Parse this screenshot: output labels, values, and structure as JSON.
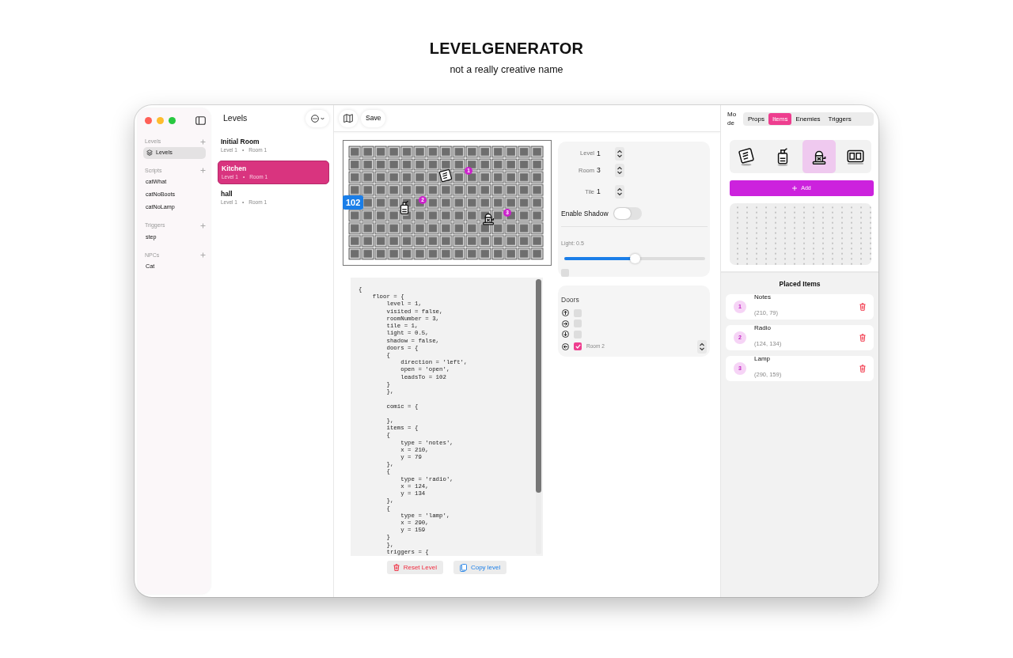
{
  "header": {
    "title": "LEVELGENERATOR",
    "subtitle": "not a really creative name"
  },
  "sidebar": {
    "sections": [
      {
        "title": "Levels",
        "items": [
          {
            "label": "Levels",
            "selected": true
          }
        ]
      },
      {
        "title": "Scripts",
        "items": [
          {
            "label": "catWhat",
            "selected": false
          },
          {
            "label": "catNoBoots",
            "selected": false
          },
          {
            "label": "catNoLamp",
            "selected": false
          }
        ]
      },
      {
        "title": "Triggers",
        "items": [
          {
            "label": "step",
            "selected": false
          }
        ]
      },
      {
        "title": "NPCs",
        "items": [
          {
            "label": "Cat",
            "selected": false
          }
        ]
      }
    ]
  },
  "levels_list": {
    "title": "Levels",
    "items": [
      {
        "name": "Initial Room",
        "level": "Level 1",
        "separator": "•",
        "room": "Room 1",
        "selected": false
      },
      {
        "name": "Kitchen",
        "level": "Level 1",
        "separator": "•",
        "room": "Room 1",
        "selected": true
      },
      {
        "name": "hall",
        "level": "Level 1",
        "separator": "•",
        "room": "Room 1",
        "selected": false
      }
    ]
  },
  "toolbar": {
    "save": "Save"
  },
  "map": {
    "door_label": "102",
    "markers": [
      {
        "number": "1",
        "kind": "notebook"
      },
      {
        "number": "2",
        "kind": "bottle"
      },
      {
        "number": "3",
        "kind": "lamp"
      }
    ]
  },
  "settings": {
    "fields": [
      {
        "label": "Level",
        "value": "1"
      },
      {
        "label": "Room",
        "value": "3"
      },
      {
        "label": "Tile",
        "value": "1"
      }
    ],
    "shadow": {
      "label": "Enable Shadow",
      "on": false
    },
    "light": {
      "label": "Light: 0.5",
      "level": 0.5
    },
    "extra_checkbox": {
      "checked": false
    }
  },
  "doors": {
    "title": "Doors",
    "rows": [
      {
        "kind": "up",
        "checked": false
      },
      {
        "kind": "right",
        "checked": false
      },
      {
        "kind": "down",
        "checked": false
      },
      {
        "kind": "left",
        "checked": true,
        "target": "Room 2"
      }
    ]
  },
  "code": "{\n    floor = {\n        level = 1,\n        visited = false,\n        roomNumber = 3,\n        tile = 1,\n        light = 0.5,\n        shadow = false,\n        doors = {\n        {\n            direction = 'left',\n            open = 'open',\n            leadsTo = 102\n        }\n        },\n\n        comic = {\n\n        },\n        items = {\n        {\n            type = 'notes',\n            x = 210,\n            y = 79\n        },\n        {\n            type = 'radio',\n            x = 124,\n            y = 134\n        },\n        {\n            type = 'lamp',\n            x = 290,\n            y = 159\n        }\n        },\n        triggers = {",
  "actions": [
    {
      "kind": "reset",
      "label": "Reset Level"
    },
    {
      "kind": "copy",
      "label": "Copy level"
    }
  ],
  "mode": {
    "label": "Mode",
    "tabs": [
      {
        "label": "Props",
        "selected": false
      },
      {
        "label": "Items",
        "selected": true
      },
      {
        "label": "Enemies",
        "selected": false
      },
      {
        "label": "Triggers",
        "selected": false
      }
    ]
  },
  "picker": [
    {
      "kind": "notebook",
      "selected": false
    },
    {
      "kind": "bottle",
      "selected": false
    },
    {
      "kind": "lamp",
      "selected": true
    },
    {
      "kind": "device",
      "selected": false
    }
  ],
  "add_button": "Add",
  "placed_items": {
    "title": "Placed Items",
    "items": [
      {
        "number": "1",
        "name": "Notes",
        "coords": "(210, 79)"
      },
      {
        "number": "2",
        "name": "Radio",
        "coords": "(124, 134)"
      },
      {
        "number": "3",
        "name": "Lamp",
        "coords": "(290, 159)"
      }
    ]
  }
}
